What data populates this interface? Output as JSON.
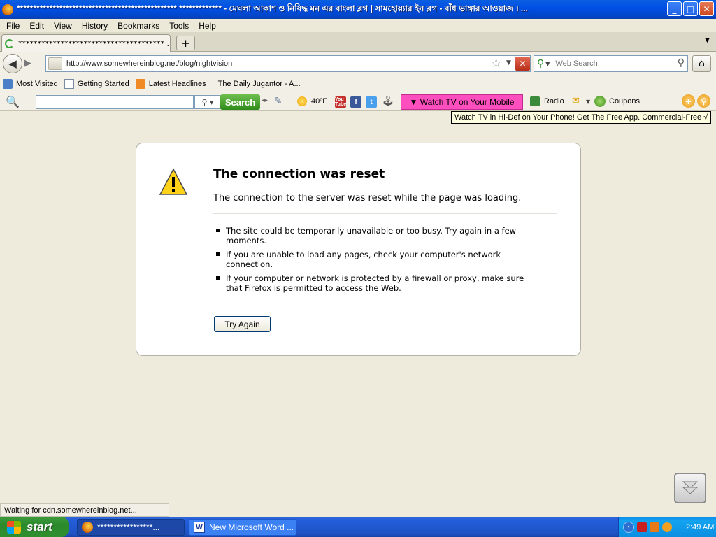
{
  "window": {
    "title": "************************************************* ************* - মেঘলা আকাশ ও নিষিদ্ধ মন এর বাংলা ব্লগ | সামহোয়্যার ইন ব্লগ - বাঁধ ভাঙ্গার আওয়াজ । ...",
    "buttons": {
      "minimize": "_",
      "maximize": "□",
      "close": "✕"
    }
  },
  "menu": [
    "File",
    "Edit",
    "View",
    "History",
    "Bookmarks",
    "Tools",
    "Help"
  ],
  "tabs": [
    {
      "title": "************************************** ...",
      "loading": true
    }
  ],
  "new_tab_label": "+",
  "nav": {
    "back_icon": "arrow-left-icon",
    "forward_icon": "arrow-right-icon",
    "url": "http://www.somewhereinblog.net/blog/nightvision",
    "search_placeholder": "Web Search"
  },
  "bookmarks": [
    {
      "label": "Most Visited",
      "icon": "most-visited-icon"
    },
    {
      "label": "Getting Started",
      "icon": "page-icon"
    },
    {
      "label": "Latest Headlines",
      "icon": "rss-icon"
    },
    {
      "label": "The Daily Jugantor - A...",
      "icon": ""
    }
  ],
  "toolbar2": {
    "search_button": "Search",
    "temperature": "40ºF",
    "youtube": "You Tube",
    "facebook": "f",
    "twitter": "t",
    "watch_tv": "▼ Watch TV on Your Mobile",
    "radio": "Radio",
    "coupons": "Coupons",
    "watch_tv_color": "#ff4fbf"
  },
  "tooltip": "Watch TV in Hi-Def on Your Phone! Get The Free App. Commercial-Free √",
  "error": {
    "title": "The connection was reset",
    "description": "The connection to the server was reset while the page was loading.",
    "bullets": [
      "The site could be temporarily unavailable or too busy. Try again in a few moments.",
      "If you are unable to load any pages, check your computer's network connection.",
      "If your computer or network is protected by a firewall or proxy, make sure that Firefox is permitted to access the Web."
    ],
    "button": "Try Again"
  },
  "status": "Waiting for cdn.somewhereinblog.net...",
  "taskbar": {
    "start": "start",
    "tasks": [
      {
        "label": "*****************...",
        "icon": "firefox-icon"
      },
      {
        "label": "New Microsoft Word ...",
        "icon": "word-icon"
      }
    ],
    "clock": "2:49 AM"
  }
}
